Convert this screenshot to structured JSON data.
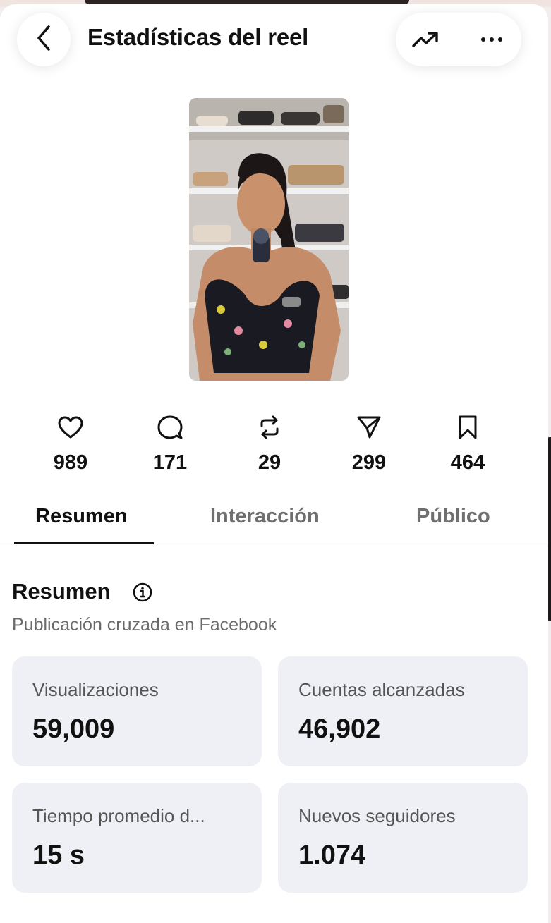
{
  "header": {
    "title": "Estadísticas del reel"
  },
  "stats": [
    {
      "icon": "heart-icon",
      "value": "989"
    },
    {
      "icon": "comment-icon",
      "value": "171"
    },
    {
      "icon": "repost-icon",
      "value": "29"
    },
    {
      "icon": "share-icon",
      "value": "299"
    },
    {
      "icon": "save-icon",
      "value": "464"
    }
  ],
  "tabs": [
    {
      "label": "Resumen",
      "active": true
    },
    {
      "label": "Interacción",
      "active": false
    },
    {
      "label": "Público",
      "active": false
    }
  ],
  "overview": {
    "title": "Resumen",
    "subtitle": "Publicación cruzada en Facebook",
    "cards": [
      {
        "label": "Visualizaciones",
        "value": "59,009"
      },
      {
        "label": "Cuentas alcanzadas",
        "value": "46,902"
      },
      {
        "label": "Tiempo promedio d...",
        "value": "15 s"
      },
      {
        "label": "Nuevos seguidores",
        "value": "1.074"
      }
    ]
  }
}
